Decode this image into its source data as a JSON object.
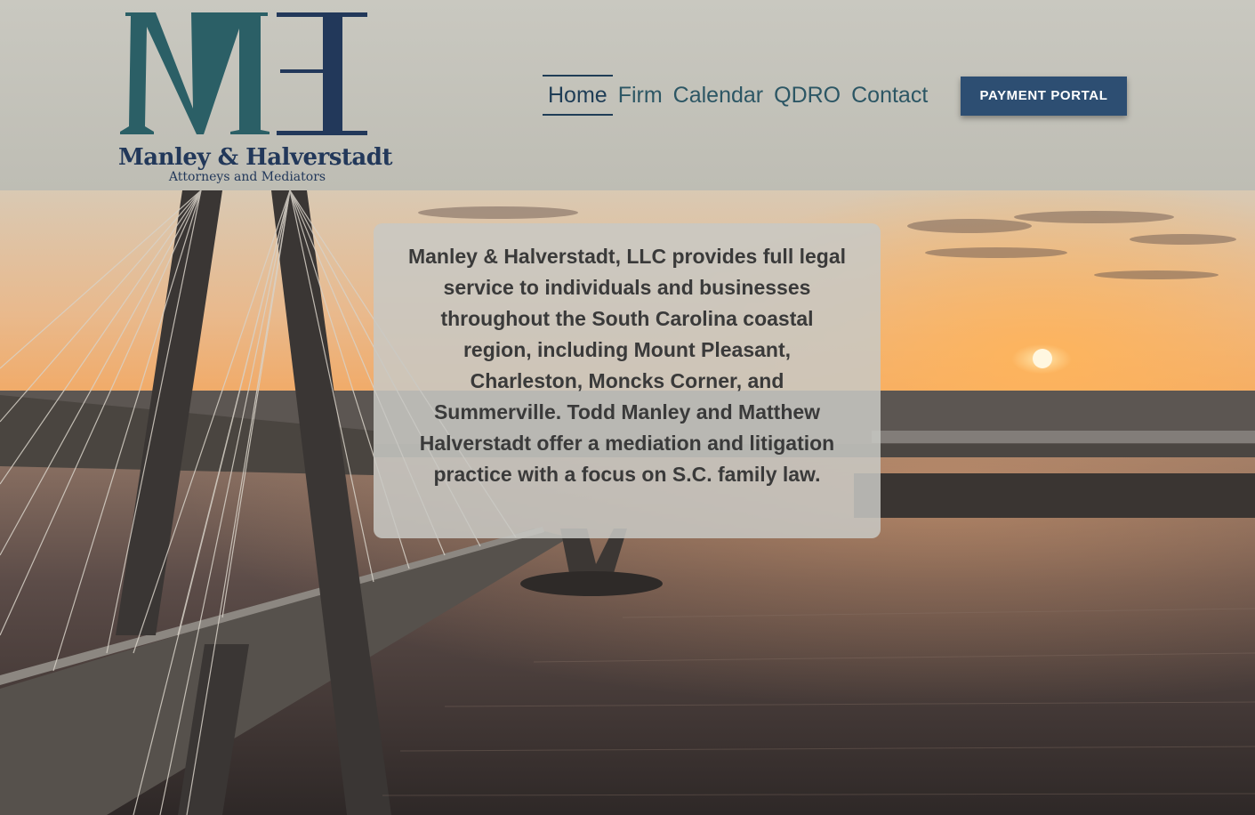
{
  "brand": {
    "monogram": "MH",
    "name": "Manley & Halverstadt",
    "tagline": "Attorneys and Mediators",
    "colors": {
      "m_letter": "#2b5f66",
      "h_letter": "#22385a"
    }
  },
  "nav": {
    "items": [
      {
        "label": "Home",
        "active": true
      },
      {
        "label": "Firm",
        "active": false
      },
      {
        "label": "Calendar",
        "active": false
      },
      {
        "label": "QDRO",
        "active": false
      },
      {
        "label": "Contact",
        "active": false
      }
    ],
    "payment_button": "PAYMENT PORTAL"
  },
  "hero": {
    "intro": "Manley & Halverstadt, LLC provides full legal service to individuals and businesses throughout the South Carolina coastal region, including Mount Pleasant, Charleston, Moncks Corner, and Summerville. Todd Manley and Matthew Halverstadt offer a mediation and litigation practice with a focus on S.C. family law."
  },
  "colors": {
    "header_bg": "#c4c3bb",
    "button_bg": "#2d4e72",
    "nav_text": "#2c5664",
    "nav_active": "#1f3d56"
  }
}
